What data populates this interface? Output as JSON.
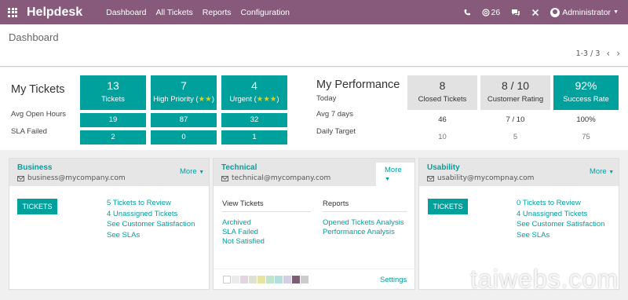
{
  "navbar": {
    "brand": "Helpdesk",
    "menu": [
      "Dashboard",
      "All Tickets",
      "Reports",
      "Configuration"
    ],
    "notifications": "26",
    "user": "Administrator"
  },
  "control_panel": {
    "breadcrumb": "Dashboard",
    "pager": "1-3 / 3"
  },
  "my_tickets": {
    "title": "My Tickets",
    "row_labels": [
      "Avg Open Hours",
      "SLA Failed"
    ],
    "columns": [
      {
        "value": "13",
        "label": "Tickets",
        "stars": "",
        "avg": "19",
        "sla": "2"
      },
      {
        "value": "7",
        "label": "High Priority (",
        "stars": "★★",
        "label_end": ")",
        "avg": "87",
        "sla": "0"
      },
      {
        "value": "4",
        "label": "Urgent (",
        "stars": "★★★",
        "label_end": ")",
        "avg": "32",
        "sla": "1"
      }
    ]
  },
  "my_performance": {
    "title": "My Performance",
    "row_labels": [
      "Today",
      "Avg 7 days",
      "Daily Target"
    ],
    "columns": [
      {
        "value": "8",
        "label": "Closed Tickets",
        "avg": "46",
        "target": "10"
      },
      {
        "value": "8 / 10",
        "label": "Customer Rating",
        "avg": "7 / 10",
        "target": "5"
      },
      {
        "value": "92%",
        "label": "Success Rate",
        "avg": "100%",
        "target": "75"
      }
    ]
  },
  "teams": [
    {
      "name": "Business",
      "email": "business@mycompany.com",
      "more": "More",
      "button": "TICKETS",
      "links": [
        "5 Tickets to Review",
        "4 Unassigned Tickets",
        "See Customer Satisfaction",
        "See SLAs"
      ]
    },
    {
      "name": "Technical",
      "email": "technical@mycompany.com",
      "more": "More",
      "view_title": "View Tickets",
      "view_links": [
        "Archived",
        "SLA Failed",
        "Not Satisfied"
      ],
      "reports_title": "Reports",
      "reports_links": [
        "Opened Tickets Analysis",
        "Performance Analysis"
      ],
      "settings": "Settings",
      "colors": [
        "#ffffff",
        "#ebebeb",
        "#e2d5e0",
        "#dfe2d0",
        "#e5e5a0",
        "#bde6cc",
        "#b3dfdc",
        "#d4cfe5",
        "#7d5c76",
        "#cccccc"
      ]
    },
    {
      "name": "Usability",
      "email": "usability@mycompnay.com",
      "more": "More",
      "button": "TICKETS",
      "links": [
        "0 Tickets to Review",
        "4 Unassigned Tickets",
        "See Customer Satisfaction",
        "See SLAs"
      ]
    }
  ],
  "watermark": "taiwebs.com"
}
